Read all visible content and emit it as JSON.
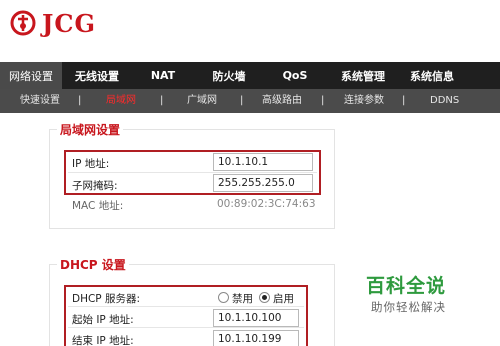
{
  "brand": {
    "name": "JCG",
    "color": "#c8161d",
    "icon": "jcg-logo-icon"
  },
  "main_nav": [
    {
      "label": "网络设置",
      "active": true
    },
    {
      "label": "无线设置",
      "active": false
    },
    {
      "label": "NAT",
      "active": false
    },
    {
      "label": "防火墙",
      "active": false
    },
    {
      "label": "QoS",
      "active": false
    },
    {
      "label": "系统管理",
      "active": false
    },
    {
      "label": "系统信息",
      "active": false
    }
  ],
  "sub_nav": [
    {
      "label": "快速设置",
      "active": false
    },
    {
      "label": "局域网",
      "active": true
    },
    {
      "label": "广域网",
      "active": false
    },
    {
      "label": "高级路由",
      "active": false
    },
    {
      "label": "连接参数",
      "active": false
    },
    {
      "label": "DDNS",
      "active": false
    }
  ],
  "sub_nav_separator": "|",
  "lan": {
    "title": "局域网设置",
    "ip_label": "IP 地址:",
    "ip_value": "10.1.10.1",
    "mask_label": "子网掩码:",
    "mask_value": "255.255.255.0",
    "mac_label": "MAC 地址:",
    "mac_value": "00:89:02:3C:74:63"
  },
  "dhcp": {
    "title": "DHCP 设置",
    "server_label": "DHCP 服务器:",
    "disable_label": "禁用",
    "enable_label": "启用",
    "enabled": true,
    "start_label": "起始 IP 地址:",
    "start_value": "10.1.10.100",
    "end_label": "结束 IP 地址:",
    "end_value": "10.1.10.199"
  },
  "watermark": {
    "title": "百科全说",
    "subtitle": "助你轻松解决"
  }
}
